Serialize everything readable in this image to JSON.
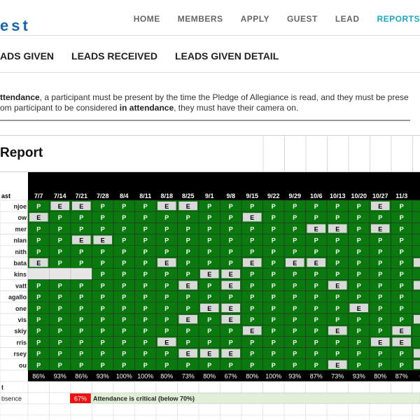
{
  "brand": {
    "logo_text": "est"
  },
  "topnav": [
    {
      "label": "HOME",
      "active": false
    },
    {
      "label": "MEMBERS",
      "active": false
    },
    {
      "label": "APPLY",
      "active": false
    },
    {
      "label": "GUEST",
      "active": false
    },
    {
      "label": "LEAD",
      "active": false
    },
    {
      "label": "REPORTS",
      "active": true
    }
  ],
  "subnav": [
    "ADS GIVEN",
    "LEADS RECEIVED",
    "LEADS GIVEN DETAIL"
  ],
  "notice": {
    "line1_bold": "ttendance",
    "line1_text": ", a participant must be present by the time the Pledge of Allegiance is read, and they must be prese",
    "line2_text": "om participant to be considered ",
    "line2_bold": "in attendance",
    "line2_end": ", they must have their camera on."
  },
  "report": {
    "title": "Report",
    "name_header": "ast",
    "dates": [
      "7/7",
      "7/14",
      "7/21",
      "7/28",
      "8/4",
      "8/11",
      "8/18",
      "8/25",
      "9/1",
      "9/8",
      "9/15",
      "9/22",
      "9/29",
      "10/6",
      "10/13",
      "10/20",
      "10/27",
      "11/3",
      "11"
    ],
    "rows": [
      {
        "name": "njoe",
        "marks": [
          "P",
          "E",
          "E",
          "P",
          "P",
          "P",
          "E",
          "E",
          "P",
          "P",
          "P",
          "P",
          "P",
          "P",
          "P",
          "P",
          "E",
          "P",
          "P"
        ]
      },
      {
        "name": "ow",
        "marks": [
          "E",
          "P",
          "P",
          "P",
          "P",
          "P",
          "P",
          "P",
          "P",
          "P",
          "E",
          "P",
          "P",
          "P",
          "P",
          "P",
          "P",
          "P",
          "P"
        ]
      },
      {
        "name": "mer",
        "marks": [
          "P",
          "P",
          "P",
          "P",
          "P",
          "P",
          "P",
          "P",
          "P",
          "P",
          "P",
          "P",
          "P",
          "E",
          "E",
          "P",
          "E",
          "P",
          "P"
        ]
      },
      {
        "name": "nlan",
        "marks": [
          "P",
          "P",
          "E",
          "E",
          "P",
          "P",
          "P",
          "P",
          "P",
          "P",
          "P",
          "P",
          "P",
          "P",
          "P",
          "P",
          "P",
          "P",
          "P"
        ]
      },
      {
        "name": "nith",
        "marks": [
          "P",
          "P",
          "P",
          "P",
          "P",
          "P",
          "P",
          "P",
          "P",
          "P",
          "P",
          "P",
          "P",
          "P",
          "P",
          "P",
          "P",
          "P",
          "P"
        ]
      },
      {
        "name": "bata",
        "marks": [
          "E",
          "P",
          "P",
          "P",
          "P",
          "P",
          "E",
          "P",
          "P",
          "P",
          "E",
          "P",
          "E",
          "E",
          "P",
          "P",
          "P",
          "P",
          "E"
        ]
      },
      {
        "name": "kins",
        "marks": [
          "",
          "",
          "",
          "P",
          "P",
          "P",
          "P",
          "P",
          "E",
          "E",
          "P",
          "P",
          "P",
          "P",
          "P",
          "P",
          "P",
          "P",
          "P"
        ]
      },
      {
        "name": "vatt",
        "marks": [
          "P",
          "P",
          "P",
          "P",
          "P",
          "P",
          "P",
          "E",
          "P",
          "E",
          "P",
          "P",
          "P",
          "P",
          "E",
          "P",
          "P",
          "P",
          "E"
        ]
      },
      {
        "name": "agallo",
        "marks": [
          "P",
          "P",
          "P",
          "P",
          "P",
          "P",
          "P",
          "P",
          "P",
          "P",
          "P",
          "P",
          "P",
          "P",
          "P",
          "P",
          "P",
          "P",
          "P"
        ]
      },
      {
        "name": "one",
        "marks": [
          "P",
          "P",
          "P",
          "P",
          "P",
          "P",
          "P",
          "P",
          "E",
          "E",
          "P",
          "P",
          "P",
          "P",
          "P",
          "E",
          "P",
          "P",
          "P"
        ]
      },
      {
        "name": "vis",
        "marks": [
          "P",
          "P",
          "P",
          "P",
          "P",
          "P",
          "P",
          "E",
          "P",
          "E",
          "P",
          "P",
          "P",
          "P",
          "P",
          "P",
          "P",
          "P",
          "E"
        ]
      },
      {
        "name": "skiy",
        "marks": [
          "P",
          "P",
          "P",
          "P",
          "P",
          "P",
          "P",
          "P",
          "P",
          "P",
          "E",
          "P",
          "P",
          "P",
          "E",
          "P",
          "P",
          "E",
          "P"
        ]
      },
      {
        "name": "rris",
        "marks": [
          "P",
          "P",
          "P",
          "P",
          "P",
          "P",
          "E",
          "P",
          "P",
          "P",
          "P",
          "P",
          "P",
          "P",
          "P",
          "P",
          "E",
          "E",
          "P"
        ]
      },
      {
        "name": "rsey",
        "marks": [
          "P",
          "P",
          "P",
          "P",
          "P",
          "P",
          "P",
          "E",
          "E",
          "E",
          "P",
          "P",
          "P",
          "P",
          "P",
          "P",
          "P",
          "P",
          "E"
        ]
      },
      {
        "name": "ou",
        "marks": [
          "P",
          "P",
          "P",
          "P",
          "P",
          "P",
          "P",
          "P",
          "P",
          "P",
          "P",
          "P",
          "P",
          "P",
          "E",
          "P",
          "P",
          "P",
          "E"
        ]
      }
    ],
    "percentages": [
      "86%",
      "93%",
      "86%",
      "93%",
      "100%",
      "100%",
      "80%",
      "73%",
      "80%",
      "67%",
      "80%",
      "100%",
      "93%",
      "87%",
      "73%",
      "93%",
      "80%",
      "87%",
      "60"
    ],
    "extra_row_label": "t",
    "legend_row_label": "bsence",
    "legend_value": "67%",
    "legend_text": "Attendance is critical (below 70%)"
  },
  "colors": {
    "accent": "#1ba8c7",
    "brand": "#1565a8",
    "present": "#0a7a0e",
    "excused": "#d9d9d9",
    "critical": "#ee1111",
    "legend_bg": "#e2f0d9",
    "header_bg": "#000000"
  }
}
